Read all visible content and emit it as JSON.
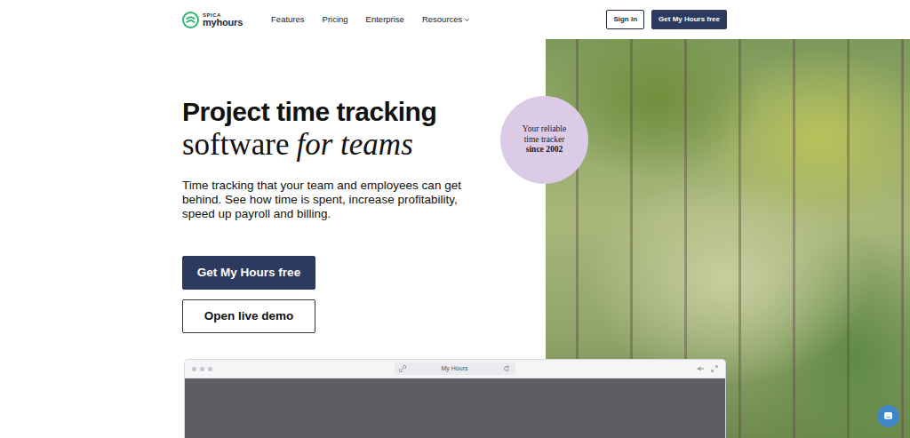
{
  "header": {
    "logo": {
      "brand": "SPICA",
      "product": "myhours"
    },
    "nav": [
      {
        "label": "Features",
        "kind": "link"
      },
      {
        "label": "Pricing",
        "kind": "link"
      },
      {
        "label": "Enterprise",
        "kind": "link"
      },
      {
        "label": "Resources",
        "kind": "dropdown"
      }
    ],
    "sign_in": "Sign in",
    "cta": "Get My Hours free"
  },
  "hero": {
    "title": "Project time tracking",
    "subtitle": "software",
    "subtitle_italic": "for teams",
    "description": "Time tracking that your team and employees can get behind. See how time is spent, increase profitability, speed up payroll and billing.",
    "primary_button": "Get My Hours free",
    "secondary_button": "Open live demo",
    "badge": [
      "Your reliable",
      "time tracker",
      "since 2002"
    ]
  },
  "preview": {
    "title": "My Hours"
  }
}
